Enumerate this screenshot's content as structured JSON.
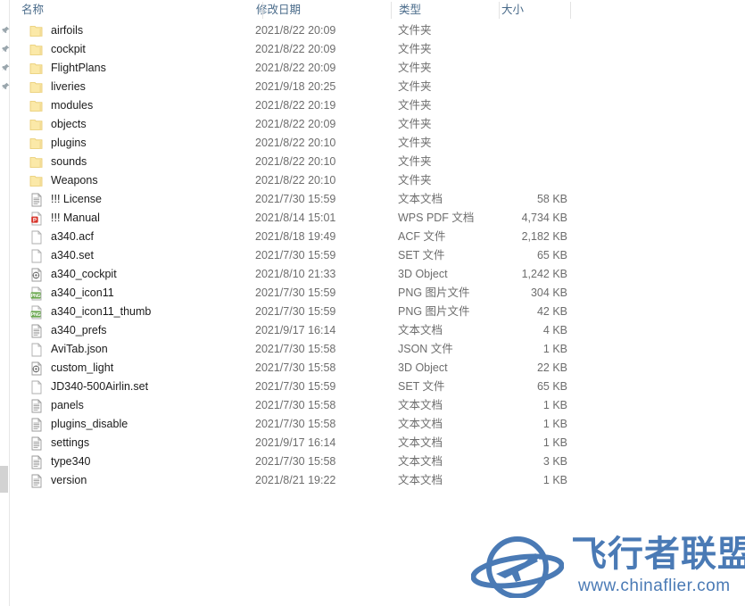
{
  "header": {
    "columns": [
      {
        "id": "name",
        "label": "名称"
      },
      {
        "id": "date",
        "label": "修改日期"
      },
      {
        "id": "type",
        "label": "类型"
      },
      {
        "id": "size",
        "label": "大小"
      }
    ]
  },
  "files": [
    {
      "name": "airfoils",
      "date": "2021/8/22 20:09",
      "type": "文件夹",
      "size": "",
      "icon": "folder-icon"
    },
    {
      "name": "cockpit",
      "date": "2021/8/22 20:09",
      "type": "文件夹",
      "size": "",
      "icon": "folder-icon"
    },
    {
      "name": "FlightPlans",
      "date": "2021/8/22 20:09",
      "type": "文件夹",
      "size": "",
      "icon": "folder-icon"
    },
    {
      "name": "liveries",
      "date": "2021/9/18 20:25",
      "type": "文件夹",
      "size": "",
      "icon": "folder-icon"
    },
    {
      "name": "modules",
      "date": "2021/8/22 20:19",
      "type": "文件夹",
      "size": "",
      "icon": "folder-icon"
    },
    {
      "name": "objects",
      "date": "2021/8/22 20:09",
      "type": "文件夹",
      "size": "",
      "icon": "folder-icon"
    },
    {
      "name": "plugins",
      "date": "2021/8/22 20:10",
      "type": "文件夹",
      "size": "",
      "icon": "folder-icon"
    },
    {
      "name": "sounds",
      "date": "2021/8/22 20:10",
      "type": "文件夹",
      "size": "",
      "icon": "folder-icon"
    },
    {
      "name": "Weapons",
      "date": "2021/8/22 20:10",
      "type": "文件夹",
      "size": "",
      "icon": "folder-icon"
    },
    {
      "name": "!!! License",
      "date": "2021/7/30 15:59",
      "type": "文本文档",
      "size": "58 KB",
      "icon": "text-document-icon"
    },
    {
      "name": "!!! Manual",
      "date": "2021/8/14 15:01",
      "type": "WPS PDF 文档",
      "size": "4,734 KB",
      "icon": "pdf-document-icon"
    },
    {
      "name": "a340.acf",
      "date": "2021/8/18 19:49",
      "type": "ACF 文件",
      "size": "2,182 KB",
      "icon": "blank-document-icon"
    },
    {
      "name": "a340.set",
      "date": "2021/7/30 15:59",
      "type": "SET 文件",
      "size": "65 KB",
      "icon": "blank-document-icon"
    },
    {
      "name": "a340_cockpit",
      "date": "2021/8/10 21:33",
      "type": "3D Object",
      "size": "1,242 KB",
      "icon": "object-3d-icon"
    },
    {
      "name": "a340_icon11",
      "date": "2021/7/30 15:59",
      "type": "PNG 图片文件",
      "size": "304 KB",
      "icon": "png-image-icon"
    },
    {
      "name": "a340_icon11_thumb",
      "date": "2021/7/30 15:59",
      "type": "PNG 图片文件",
      "size": "42 KB",
      "icon": "png-image-icon"
    },
    {
      "name": "a340_prefs",
      "date": "2021/9/17 16:14",
      "type": "文本文档",
      "size": "4 KB",
      "icon": "text-document-icon"
    },
    {
      "name": "AviTab.json",
      "date": "2021/7/30 15:58",
      "type": "JSON 文件",
      "size": "1 KB",
      "icon": "blank-document-icon"
    },
    {
      "name": "custom_light",
      "date": "2021/7/30 15:58",
      "type": "3D Object",
      "size": "22 KB",
      "icon": "object-3d-icon"
    },
    {
      "name": "JD340-500Airlin.set",
      "date": "2021/7/30 15:59",
      "type": "SET 文件",
      "size": "65 KB",
      "icon": "blank-document-icon"
    },
    {
      "name": "panels",
      "date": "2021/7/30 15:58",
      "type": "文本文档",
      "size": "1 KB",
      "icon": "text-document-icon"
    },
    {
      "name": "plugins_disable",
      "date": "2021/7/30 15:58",
      "type": "文本文档",
      "size": "1 KB",
      "icon": "text-document-icon"
    },
    {
      "name": "settings",
      "date": "2021/9/17 16:14",
      "type": "文本文档",
      "size": "1 KB",
      "icon": "text-document-icon"
    },
    {
      "name": "type340",
      "date": "2021/7/30 15:58",
      "type": "文本文档",
      "size": "3 KB",
      "icon": "text-document-icon"
    },
    {
      "name": "version",
      "date": "2021/8/21 19:22",
      "type": "文本文档",
      "size": "1 KB",
      "icon": "text-document-icon"
    }
  ],
  "gutter": {
    "pin_count": 4,
    "pin_icon": "pin-icon",
    "scrollbar": "vertical-scrollbar-thumb"
  },
  "watermark": {
    "title": "飞行者联盟",
    "url": "www.chinaflier.com",
    "logo_icon": "airplane-globe-logo-icon",
    "color": "#4a7ab5"
  },
  "colors": {
    "header_text": "#4a6b8a",
    "row_text": "#1b1b1b",
    "meta_text": "#6d6d6d",
    "folder": "#fbe9a8",
    "folder_edge": "#e8c96a",
    "png_green": "#6aa84f",
    "pdf_red": "#d8342a",
    "background": "#ffffff"
  }
}
